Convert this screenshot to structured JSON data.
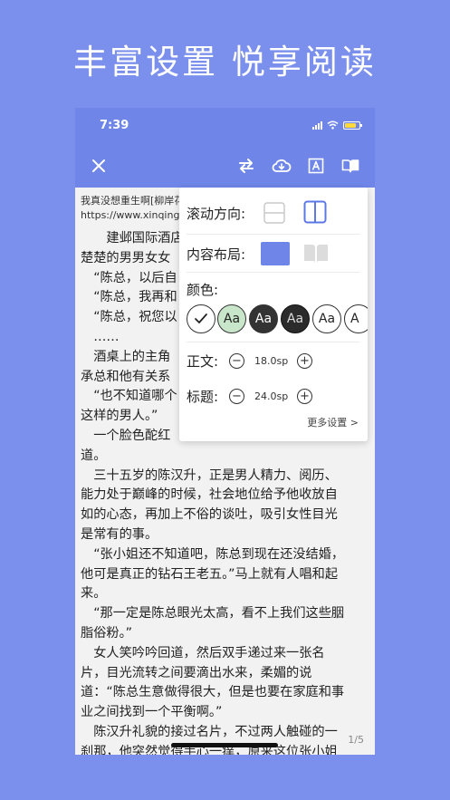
{
  "headline": "丰富设置 悦享阅读",
  "status": {
    "time": "7:39"
  },
  "book": {
    "title": "我真没想重生啊[柳岸花",
    "url": "https://www.xinqingxi"
  },
  "content": {
    "lines": [
      "　　建邺国际酒店",
      "楚楚的男男女女",
      "　“陈总，以后自",
      "　“陈总，我再和",
      "　“陈总，祝您以",
      "　……",
      "　酒桌上的主角",
      "承总和他有关系",
      "　“也不知道哪个",
      "这样的男人。”",
      "　一个脸色酡红",
      "道。",
      "　三十五岁的陈汉升，正是男人精力、阅历、",
      "能力处于巅峰的时候，社会地位给予他收放自",
      "如的心态，再加上不俗的谈吐，吸引女性目光",
      "是常有的事。",
      "　“张小姐还不知道吧，陈总到现在还没结婚，",
      "他可是真正的钻石王老五。”马上就有人唱和起",
      "来。",
      "　“那一定是陈总眼光太高，看不上我们这些胭",
      "脂俗粉。”",
      "　女人笑吟吟回道，然后双手递过来一张名",
      "片，目光流转之间要滴出水来，柔媚的说",
      "道：“陈总生意做得很大，但是也要在家庭和事",
      "业之间找到一个平衡啊。”",
      "　陈汉升礼貌的接过名片，不过两人触碰的一",
      "刹那，他突然觉得手心一痒，原来这位张小姐"
    ],
    "page_indicator": "1/5"
  },
  "settings": {
    "scroll_direction_label": "滚动方向:",
    "layout_label": "内容布局:",
    "color_label": "颜色:",
    "color_swatch_text": "Aa",
    "color_swatch_partial": "A",
    "body_label": "正文:",
    "body_size": "18.0sp",
    "title_label": "标题:",
    "title_size": "24.0sp",
    "minus": "−",
    "plus": "+",
    "more": "更多设置 >"
  },
  "colors": {
    "background": "#7b8fed",
    "toolbar": "#6f86e8",
    "accent": "#6f86e8",
    "swatch_green": "#c8e6c9",
    "swatch_dark": "#333333",
    "swatch_darker": "#2b2b2b"
  },
  "icons": [
    "close-icon",
    "swap-icon",
    "cloud-download-icon",
    "font-a-icon",
    "book-icon",
    "check-icon"
  ]
}
